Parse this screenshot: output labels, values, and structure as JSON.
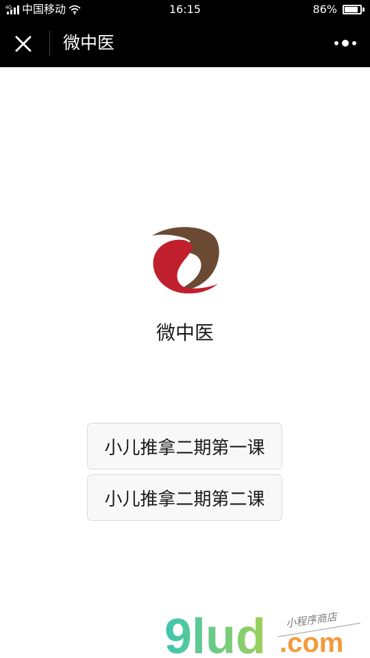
{
  "status_bar": {
    "network": "4G",
    "carrier": "中国移动",
    "time": "16:15",
    "battery_percent_text": "86%",
    "battery_level": 0.86
  },
  "nav": {
    "title": "微中医",
    "close_icon": "close-icon",
    "more_icon": "more-dots-icon"
  },
  "app": {
    "name": "微中医",
    "logo_colors": {
      "red": "#c0202e",
      "brown": "#6b4a33"
    }
  },
  "buttons": [
    {
      "label": "小儿推拿二期第一课"
    },
    {
      "label": "小儿推拿二期第二课"
    }
  ],
  "watermark": {
    "brand": "9lud",
    "domain": ".com",
    "tagline": "小程序商店",
    "colors": {
      "teal": "#3cc6b0",
      "green": "#9ed05a",
      "orange": "#f29a3a"
    }
  }
}
